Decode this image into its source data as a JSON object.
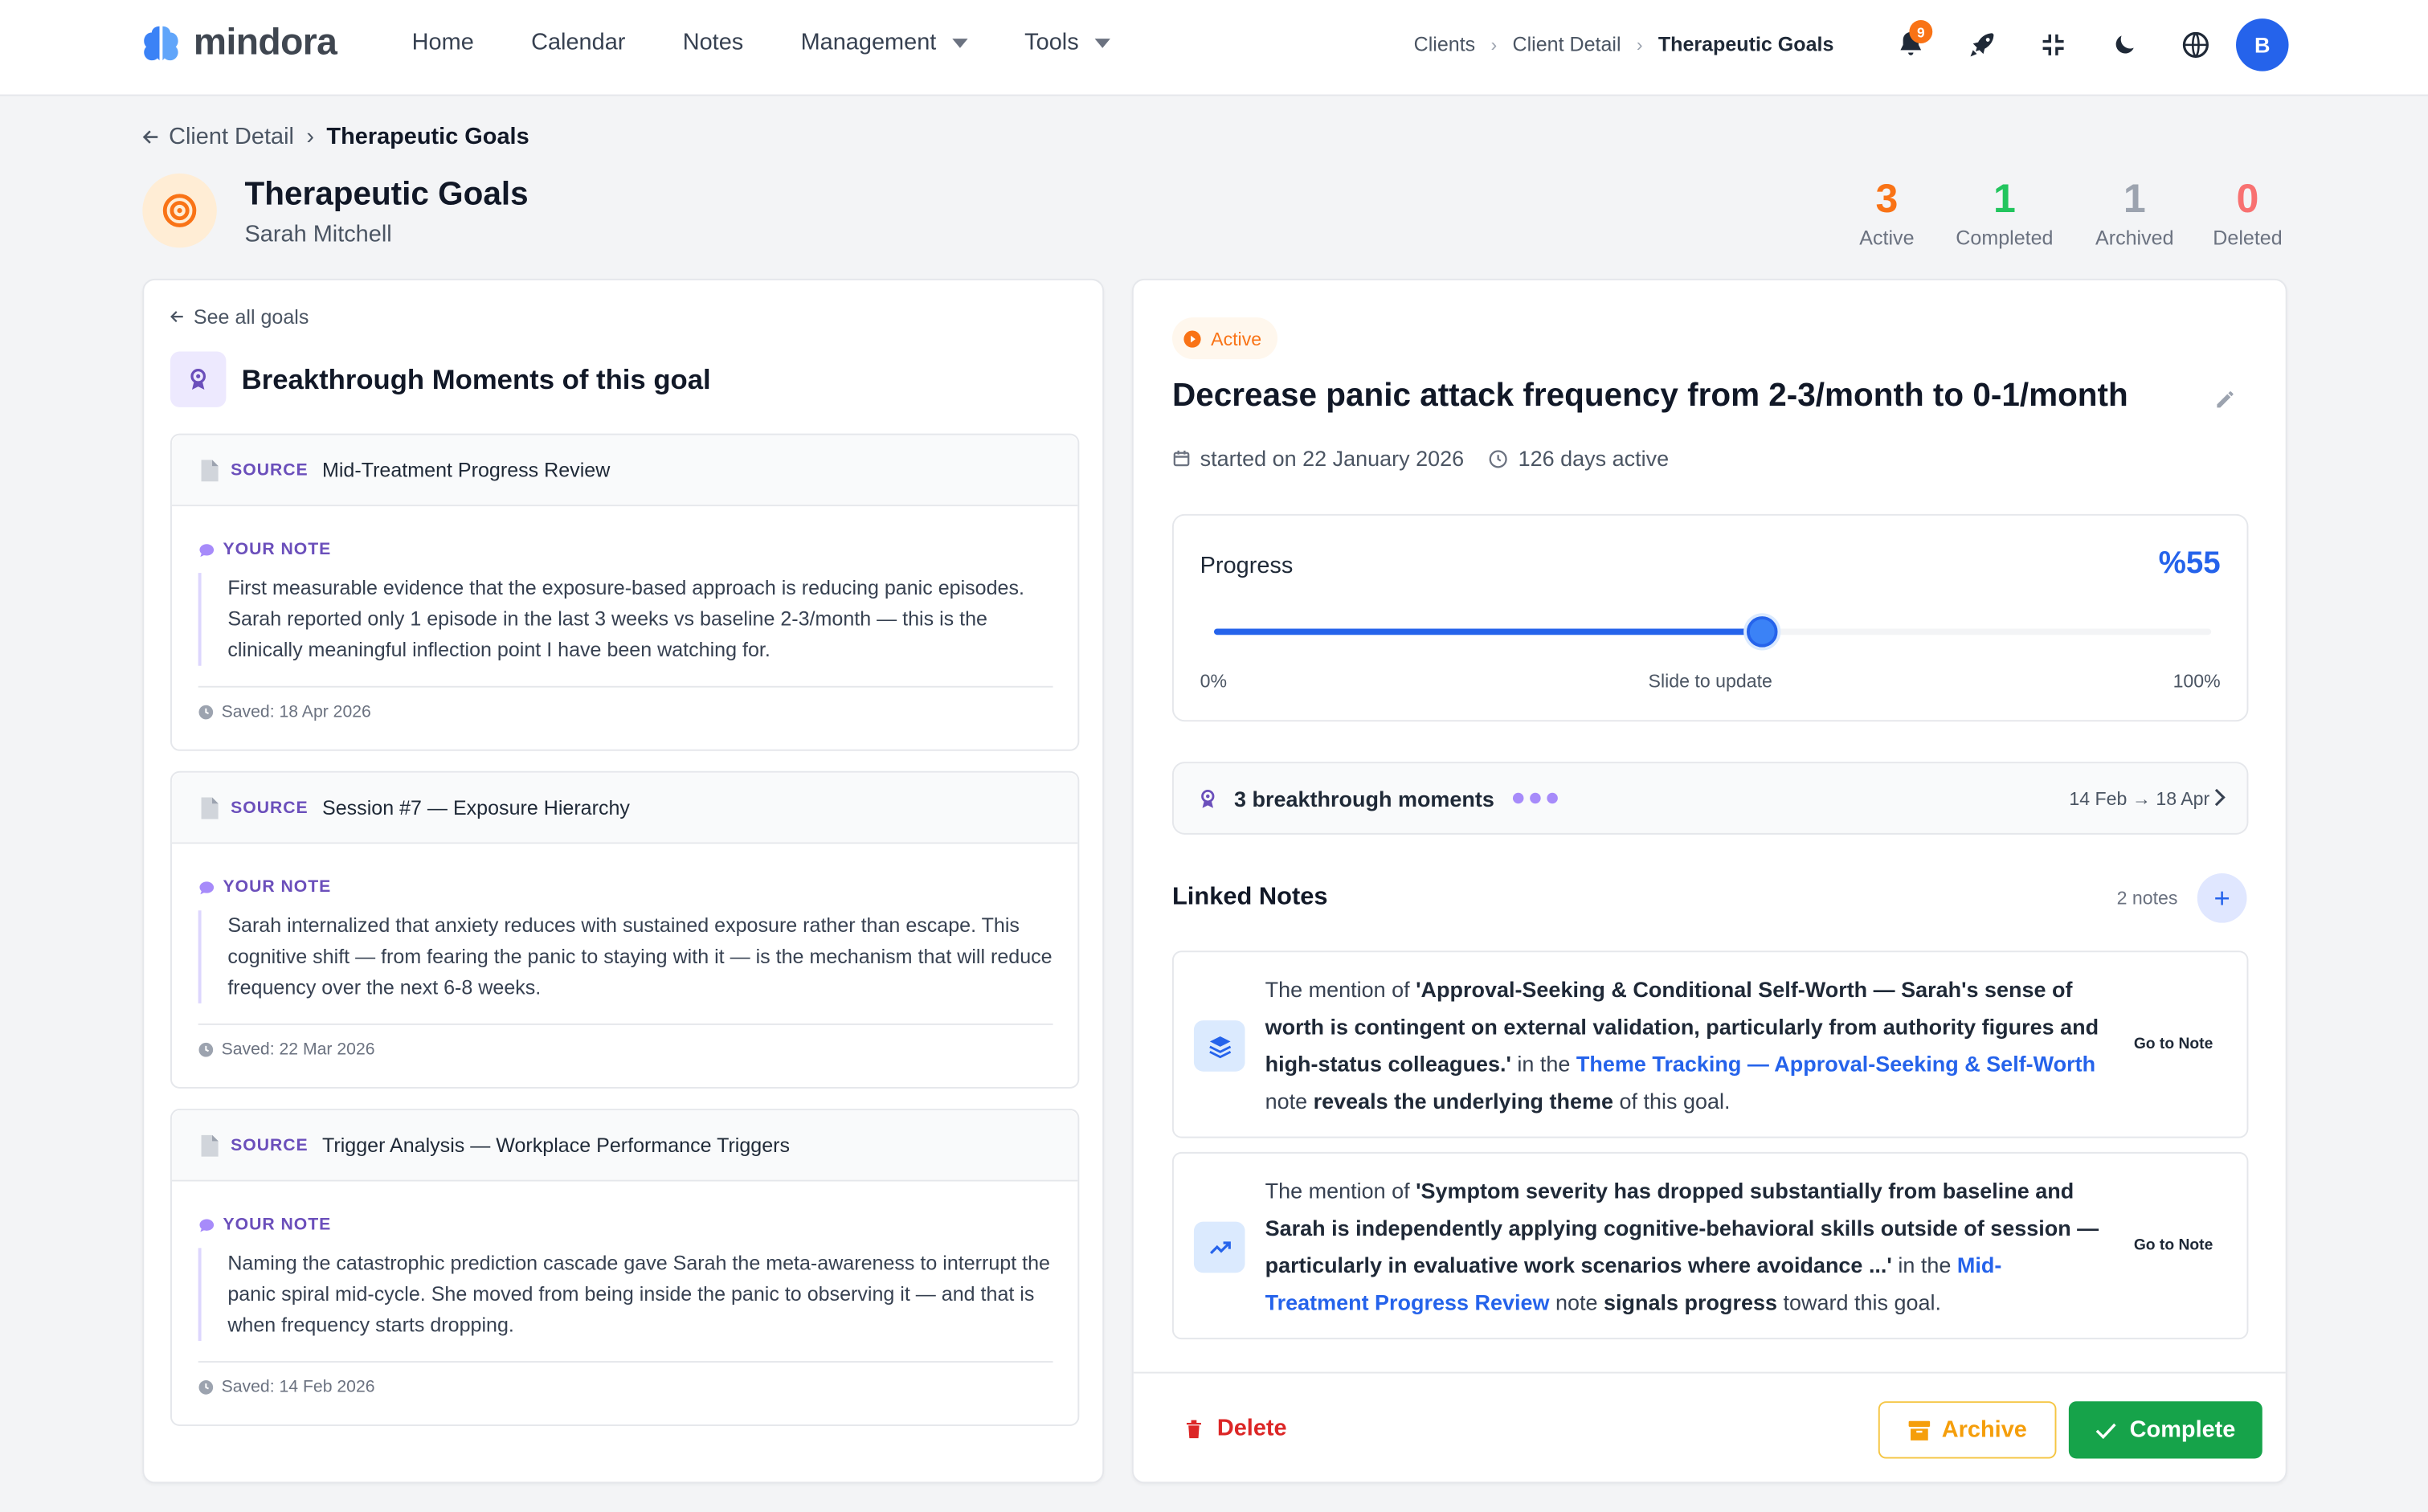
{
  "app": {
    "name": "mindora"
  },
  "nav": {
    "home": "Home",
    "calendar": "Calendar",
    "notes": "Notes",
    "management": "Management",
    "tools": "Tools"
  },
  "top_breadcrumb": [
    "Clients",
    "Client Detail",
    "Therapeutic Goals"
  ],
  "notifications": {
    "count": "9"
  },
  "user": {
    "initial": "B"
  },
  "page": {
    "back_label": "Client Detail",
    "current": "Therapeutic Goals",
    "title": "Therapeutic Goals",
    "client": "Sarah Mitchell"
  },
  "stats": [
    {
      "value": "3",
      "label": "Active",
      "color": "#f97316"
    },
    {
      "value": "1",
      "label": "Completed",
      "color": "#22c55e"
    },
    {
      "value": "1",
      "label": "Archived",
      "color": "#9ca3af"
    },
    {
      "value": "0",
      "label": "Deleted",
      "color": "#f87171"
    }
  ],
  "left": {
    "see_all": "See all goals",
    "title": "Breakthrough Moments of this goal",
    "source_label": "SOURCE",
    "note_label": "YOUR NOTE",
    "moments": [
      {
        "source": "Mid-Treatment Progress Review",
        "note": "First measurable evidence that the exposure-based approach is reducing panic episodes. Sarah reported only 1 episode in the last 3 weeks vs baseline 2-3/month — this is the clinically meaningful inflection point I have been watching for.",
        "saved": "Saved: 18 Apr 2026"
      },
      {
        "source": "Session #7 — Exposure Hierarchy",
        "note": "Sarah internalized that anxiety reduces with sustained exposure rather than escape. This cognitive shift — from fearing the panic to staying with it — is the mechanism that will reduce frequency over the next 6-8 weeks.",
        "saved": "Saved: 22 Mar 2026"
      },
      {
        "source": "Trigger Analysis — Workplace Performance Triggers",
        "note": "Naming the catastrophic prediction cascade gave Sarah the meta-awareness to interrupt the panic spiral mid-cycle. She moved from being inside the panic to observing it — and that is when frequency starts dropping.",
        "saved": "Saved: 14 Feb 2026"
      }
    ]
  },
  "goal": {
    "status": "Active",
    "title": "Decrease panic attack frequency from 2-3/month to 0-1/month",
    "started": "started on 22 January 2026",
    "days_active": "126 days active",
    "progress_label": "Progress",
    "progress_value": 55,
    "progress_text": "%55",
    "slider_min": "0%",
    "slider_hint": "Slide to update",
    "slider_max": "100%",
    "breakthrough_label": "3 breakthrough moments",
    "breakthrough_range": "14 Feb → 18 Apr"
  },
  "linked_notes": {
    "title": "Linked Notes",
    "count": "2 notes",
    "go_to": "Go to Note",
    "items": [
      {
        "p1": "The mention of ",
        "quote": "'Approval-Seeking & Conditional Self-Worth — Sarah's sense of worth is contingent on external validation, particularly from authority figures and high-status colleagues.'",
        "p2": " in the ",
        "link": "Theme Tracking — Approval-Seeking & Self-Worth",
        "p3": " note ",
        "verb": "reveals the underlying theme",
        "p4": " of this goal."
      },
      {
        "p1": "The mention of ",
        "quote": "'Symptom severity has dropped substantially from baseline and Sarah is independently applying cognitive-behavioral skills outside of session — particularly in evaluative work scenarios where avoidance ...'",
        "p2": " in the ",
        "link": "Mid-Treatment Progress Review",
        "p3": " note ",
        "verb": "signals progress",
        "p4": " toward this goal."
      }
    ]
  },
  "actions": {
    "delete": "Delete",
    "archive": "Archive",
    "complete": "Complete"
  }
}
